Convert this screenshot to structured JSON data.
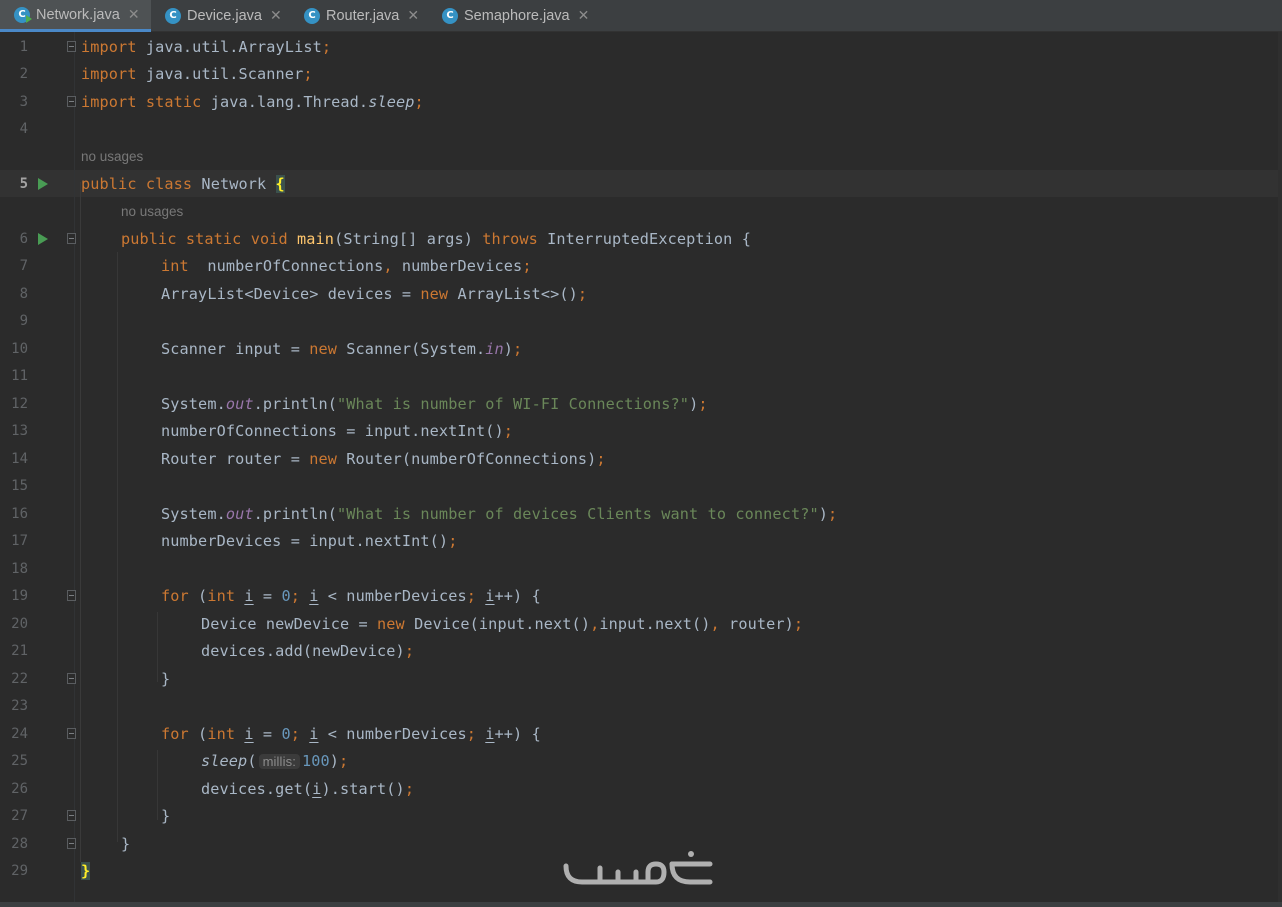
{
  "tabs": [
    {
      "label": "Network.java",
      "icon": "java-class-main-icon",
      "active": true
    },
    {
      "label": "Device.java",
      "icon": "java-class-icon",
      "active": false
    },
    {
      "label": "Router.java",
      "icon": "java-class-icon",
      "active": false
    },
    {
      "label": "Semaphore.java",
      "icon": "java-class-icon",
      "active": false
    }
  ],
  "tab_icon_letter": "C",
  "close_glyph": "✕",
  "hints": {
    "no_usages": "no usages",
    "millis": "millis:"
  },
  "line_numbers": [
    "1",
    "2",
    "3",
    "4",
    "5",
    "6",
    "7",
    "8",
    "9",
    "10",
    "11",
    "12",
    "13",
    "14",
    "15",
    "16",
    "17",
    "18",
    "19",
    "20",
    "21",
    "22",
    "23",
    "24",
    "25",
    "26",
    "27",
    "28",
    "29"
  ],
  "code": {
    "l1_a": "import",
    "l1_b": " java.util.ArrayList",
    "l1_c": ";",
    "l2_a": "import",
    "l2_b": " java.util.Scanner",
    "l2_c": ";",
    "l3_a": "import static",
    "l3_b": " java.lang.Thread.",
    "l3_c": "sleep",
    "l3_d": ";",
    "l5_a": "public class",
    "l5_b": " Network ",
    "l5_c": "{",
    "l6_a": "public static void",
    "l6_b": "main",
    "l6_c": "(String[] args) ",
    "l6_d": "throws",
    "l6_e": " InterruptedException {",
    "l7_a": "int",
    "l7_b": "  numberOfConnections",
    "l7_c": ",",
    "l7_d": " numberDevices",
    "l7_e": ";",
    "l8_a": "ArrayList<Device> devices = ",
    "l8_b": "new",
    "l8_c": " ArrayList<>()",
    "l8_d": ";",
    "l10_a": "Scanner input = ",
    "l10_b": "new",
    "l10_c": " Scanner(System.",
    "l10_d": "in",
    "l10_e": ")",
    "l10_f": ";",
    "l12_a": "System.",
    "l12_b": "out",
    "l12_c": ".println(",
    "l12_d": "\"What is number of WI-FI Connections?\"",
    "l12_e": ")",
    "l12_f": ";",
    "l13_a": "numberOfConnections = input.nextInt()",
    "l13_b": ";",
    "l14_a": "Router router = ",
    "l14_b": "new",
    "l14_c": " Router(numberOfConnections)",
    "l14_d": ";",
    "l16_a": "System.",
    "l16_b": "out",
    "l16_c": ".println(",
    "l16_d": "\"What is number of devices Clients want to connect?\"",
    "l16_e": ")",
    "l16_f": ";",
    "l17_a": "numberDevices = input.nextInt()",
    "l17_b": ";",
    "for_a": "for",
    "for_b": " (",
    "for_c": "int",
    "for_d": " ",
    "for_i": "i",
    "for_e": " = ",
    "for_f": "0",
    "for_g": ";",
    "for_h": " ",
    "for_j": " < numberDevices",
    "for_k": ";",
    "for_l": " ",
    "for_m": "++) {",
    "l20_a": "Device newDevice = ",
    "l20_b": "new",
    "l20_c": " Device(input.next()",
    "l20_d": ",",
    "l20_e": "input.next()",
    "l20_f": ",",
    "l20_g": " router)",
    "l20_h": ";",
    "l21_a": "devices.add(newDevice)",
    "l21_b": ";",
    "close_brace": "}",
    "l25_a": "sleep",
    "l25_b": "(",
    "l25_c": "100",
    "l25_d": ")",
    "l25_e": ";",
    "l26_a": "devices.get(",
    "l26_b": "i",
    "l26_c": ").start()",
    "l26_d": ";",
    "l29_a": "}"
  },
  "watermark": "خمسات",
  "colors": {
    "background": "#2b2b2b",
    "keyword": "#cc7832",
    "string": "#6a8759",
    "number": "#6897bb",
    "field": "#9876aa",
    "method_decl": "#ffc66d",
    "run_gutter": "#499c54",
    "tab_active_underline": "#4a88c7"
  }
}
